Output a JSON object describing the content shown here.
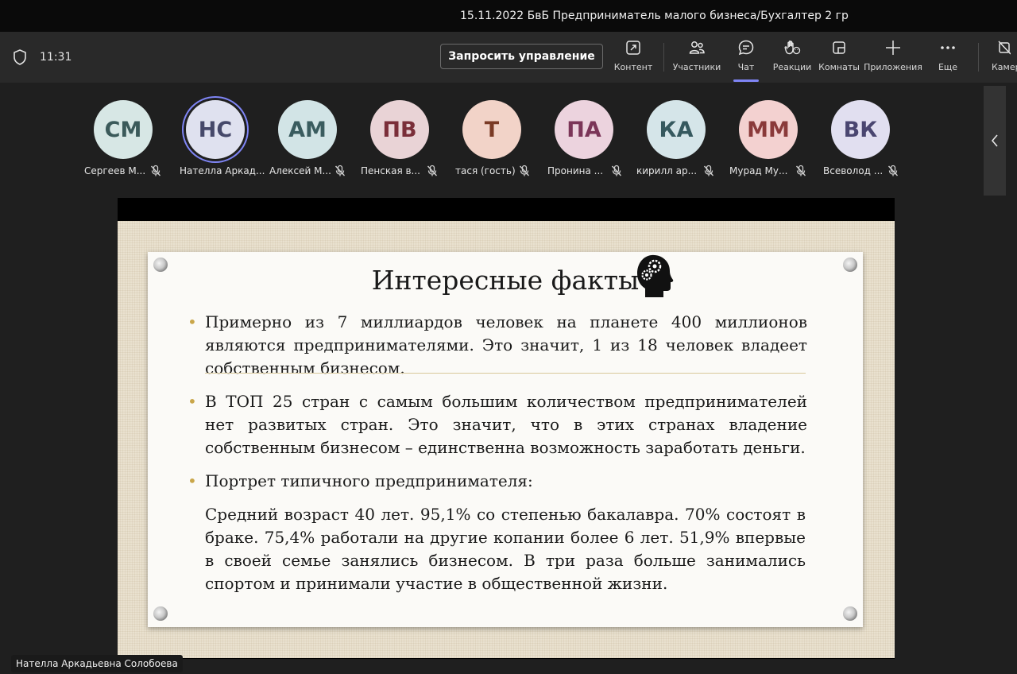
{
  "window": {
    "title": "15.11.2022 БвБ Предприниматель малого бизнеса/Бухгалтер 2 гр"
  },
  "toolbar": {
    "timer": "11:31",
    "request_control": "Запросить управление",
    "items": [
      {
        "label": "Контент",
        "icon": "share-content-icon"
      },
      {
        "label": "Участники",
        "icon": "people-icon"
      },
      {
        "label": "Чат",
        "icon": "chat-icon"
      },
      {
        "label": "Реакции",
        "icon": "raise-hand-icon"
      },
      {
        "label": "Комнаты",
        "icon": "rooms-icon"
      },
      {
        "label": "Приложения",
        "icon": "plus-icon"
      },
      {
        "label": "Еще",
        "icon": "more-icon"
      },
      {
        "label": "Камер",
        "icon": "camera-off-icon"
      }
    ]
  },
  "participants": [
    {
      "initials": "СМ",
      "name": "Сергеев М...",
      "muted": true,
      "bg": "#d7e7e5",
      "fg": "#3b5a5a"
    },
    {
      "initials": "НС",
      "name": "Нателла Аркад...",
      "muted": false,
      "speaking": true,
      "bg": "#dfe1ef",
      "fg": "#46496a"
    },
    {
      "initials": "АМ",
      "name": "Алексей М...",
      "muted": true,
      "bg": "#d2e4e6",
      "fg": "#3a5c5f"
    },
    {
      "initials": "ПВ",
      "name": "Пенская в...",
      "muted": true,
      "bg": "#e9d3d6",
      "fg": "#7a2e39"
    },
    {
      "initials": "Т",
      "name": "тася (гость)",
      "muted": true,
      "bg": "#f2d3c8",
      "fg": "#7a3a25"
    },
    {
      "initials": "ПА",
      "name": "Пронина ...",
      "muted": true,
      "bg": "#ecd3de",
      "fg": "#7b3558"
    },
    {
      "initials": "КА",
      "name": "кирилл ар...",
      "muted": true,
      "bg": "#d5e5e9",
      "fg": "#36595f"
    },
    {
      "initials": "ММ",
      "name": "Мурад Му...",
      "muted": true,
      "bg": "#f3d1d0",
      "fg": "#8a3a3a"
    },
    {
      "initials": "ВК",
      "name": "Всеволод ...",
      "muted": true,
      "bg": "#e1dff0",
      "fg": "#4a4670"
    }
  ],
  "slide": {
    "title": "Интересные факты",
    "bullets": [
      "Примерно из 7 миллиардов человек на планете 400 миллионов являются предпринимателями. Это значит, 1 из 18 человек владеет собственным бизнесом.",
      "В ТОП 25 стран с самым большим количеством предпринимателей нет развитых стран. Это значит, что в этих странах владение собственным бизнесом – единственна возможность заработать деньги.",
      "Портрет типичного предпринимателя:"
    ],
    "paragraph": "Средний возраст 40 лет. 95,1% со степенью бакалавра. 70% состоят в браке. 75,4% работали на другие копании более 6 лет. 51,9% впервые в своей семье занялись бизнесом. В три раза больше занимались спортом и принимали участие в общественной жизни."
  },
  "presenter": {
    "name": "Нателла Аркадьевна Солобоева"
  },
  "colors": {
    "accent": "#7f85f5",
    "bullet": "#c9a64a"
  }
}
